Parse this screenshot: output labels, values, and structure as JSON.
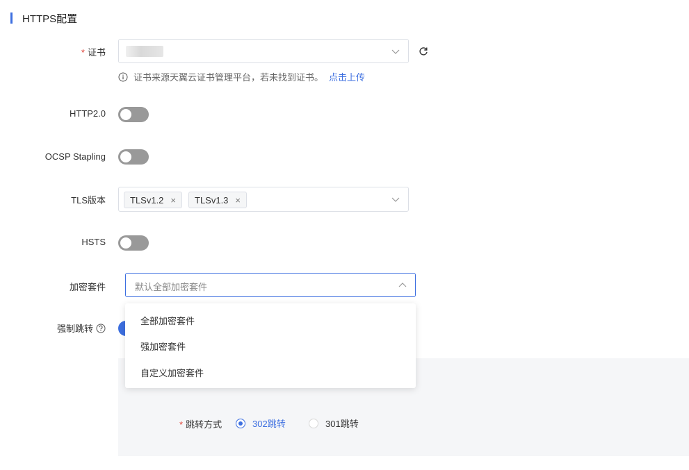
{
  "section": {
    "title": "HTTPS配置"
  },
  "certificate": {
    "label": "证书",
    "hint": "证书来源天翼云证书管理平台，若未找到证书。",
    "hint_link": "点击上传"
  },
  "http2": {
    "label": "HTTP2.0",
    "enabled": false
  },
  "ocsp": {
    "label": "OCSP Stapling",
    "enabled": false
  },
  "tls": {
    "label": "TLS版本",
    "tags": [
      "TLSv1.2",
      "TLSv1.3"
    ]
  },
  "hsts": {
    "label": "HSTS",
    "enabled": false
  },
  "cipher": {
    "label": "加密套件",
    "placeholder": "默认全部加密套件",
    "options": [
      "全部加密套件",
      "强加密套件",
      "自定义加密套件"
    ]
  },
  "force_redirect": {
    "label": "强制跳转",
    "enabled": true
  },
  "redirect_method": {
    "label": "跳转方式",
    "options": [
      "302跳转",
      "301跳转"
    ],
    "selected": "302跳转"
  },
  "colors": {
    "accent": "#3d6fe0",
    "required": "#e0453a",
    "switch_off": "#999999"
  }
}
